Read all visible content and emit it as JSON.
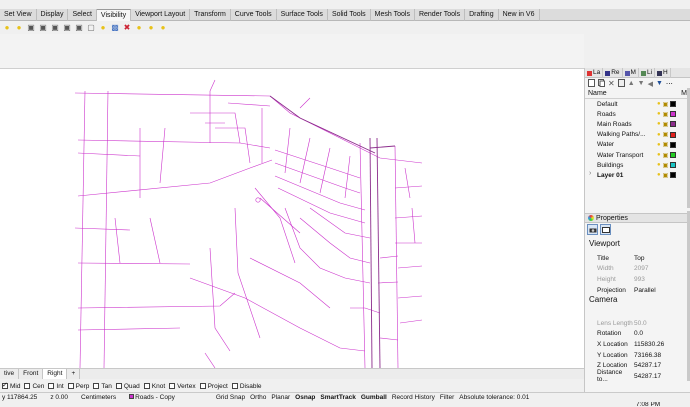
{
  "tabs": [
    "Set View",
    "Display",
    "Select",
    "Visibility",
    "Viewport Layout",
    "Transform",
    "Curve Tools",
    "Surface Tools",
    "Solid Tools",
    "Mesh Tools",
    "Render Tools",
    "Drafting",
    "New in V6"
  ],
  "active_tab": "Visibility",
  "toolbar_icons": [
    "lightbulb-icon",
    "lightbulb-icon",
    "lock-icon",
    "lock-icon",
    "lock-icon",
    "lock-icon",
    "lock-icon",
    "hide-icon",
    "lightbulb-icon",
    "select-icon",
    "isolate-icon",
    "lightbulb-icon",
    "lightbulb-icon",
    "lightbulb-icon"
  ],
  "viewport_tabs": [
    "tive",
    "Front",
    "Right"
  ],
  "viewport_add": "+",
  "osnap": [
    {
      "label": "Mid",
      "checked": true
    },
    {
      "label": "Cen",
      "checked": false
    },
    {
      "label": "Int",
      "checked": false
    },
    {
      "label": "Perp",
      "checked": false
    },
    {
      "label": "Tan",
      "checked": false
    },
    {
      "label": "Quad",
      "checked": false
    },
    {
      "label": "Knot",
      "checked": false
    },
    {
      "label": "Vertex",
      "checked": false
    },
    {
      "label": "Project",
      "checked": false
    },
    {
      "label": "Disable",
      "checked": false
    }
  ],
  "status": {
    "y": "y 117864.25",
    "z": "z 0.00",
    "units": "Centimeters",
    "layer": "Roads - Copy",
    "grid_snap": "Grid Snap",
    "ortho": "Ortho",
    "planar": "Planar",
    "osnap": "Osnap",
    "smarttrack": "SmartTrack",
    "gumball": "Gumball",
    "record": "Record History",
    "filter": "Filter",
    "tolerance": "Absolute tolerance: 0.01",
    "clock": "7:08 PM"
  },
  "panel_tabs": [
    {
      "label": "La",
      "icon": "layers-icon"
    },
    {
      "label": "Re",
      "icon": "render-icon"
    },
    {
      "label": "M",
      "icon": "materials-icon"
    },
    {
      "label": "Li",
      "icon": "libraries-icon"
    },
    {
      "label": "H",
      "icon": "help-icon"
    }
  ],
  "layers_header": {
    "name": "Name",
    "mat": "M"
  },
  "layers": [
    {
      "name": "Default",
      "color": "#000000",
      "bold": false
    },
    {
      "name": "Roads",
      "color": "#cc33cc",
      "bold": false
    },
    {
      "name": "Main Roads",
      "color": "#8c2d8c",
      "bold": false
    },
    {
      "name": "Walking Paths/...",
      "color": "#e0201c",
      "bold": false
    },
    {
      "name": "Water",
      "color": "#000000",
      "bold": false
    },
    {
      "name": "Water Transport",
      "color": "#22cc22",
      "bold": false
    },
    {
      "name": "Buildings",
      "color": "#19c4c4",
      "bold": false
    },
    {
      "name": "Layer 01",
      "color": "#000000",
      "bold": true
    }
  ],
  "properties_title": "Properties",
  "viewport_section": "Viewport",
  "viewport_props": [
    {
      "key": "Title",
      "value": "Top",
      "dim": false
    },
    {
      "key": "Width",
      "value": "2097",
      "dim": true
    },
    {
      "key": "Height",
      "value": "993",
      "dim": true
    },
    {
      "key": "Projection",
      "value": "Parallel",
      "dim": false
    }
  ],
  "camera_section": "Camera",
  "camera_props": [
    {
      "key": "Lens Length",
      "value": "50.0",
      "dim": true
    },
    {
      "key": "Rotation",
      "value": "0.0",
      "dim": false
    },
    {
      "key": "X Location",
      "value": "115830.26",
      "dim": false
    },
    {
      "key": "Y Location",
      "value": "73166.38",
      "dim": false
    },
    {
      "key": "Z Location",
      "value": "54287.17",
      "dim": false
    },
    {
      "key": "Distance to...",
      "value": "54287.17",
      "dim": false
    }
  ],
  "colors": {
    "road": "#cc33cc",
    "main_road": "#8c2d8c",
    "panel_bg": "#f4f4f4"
  }
}
